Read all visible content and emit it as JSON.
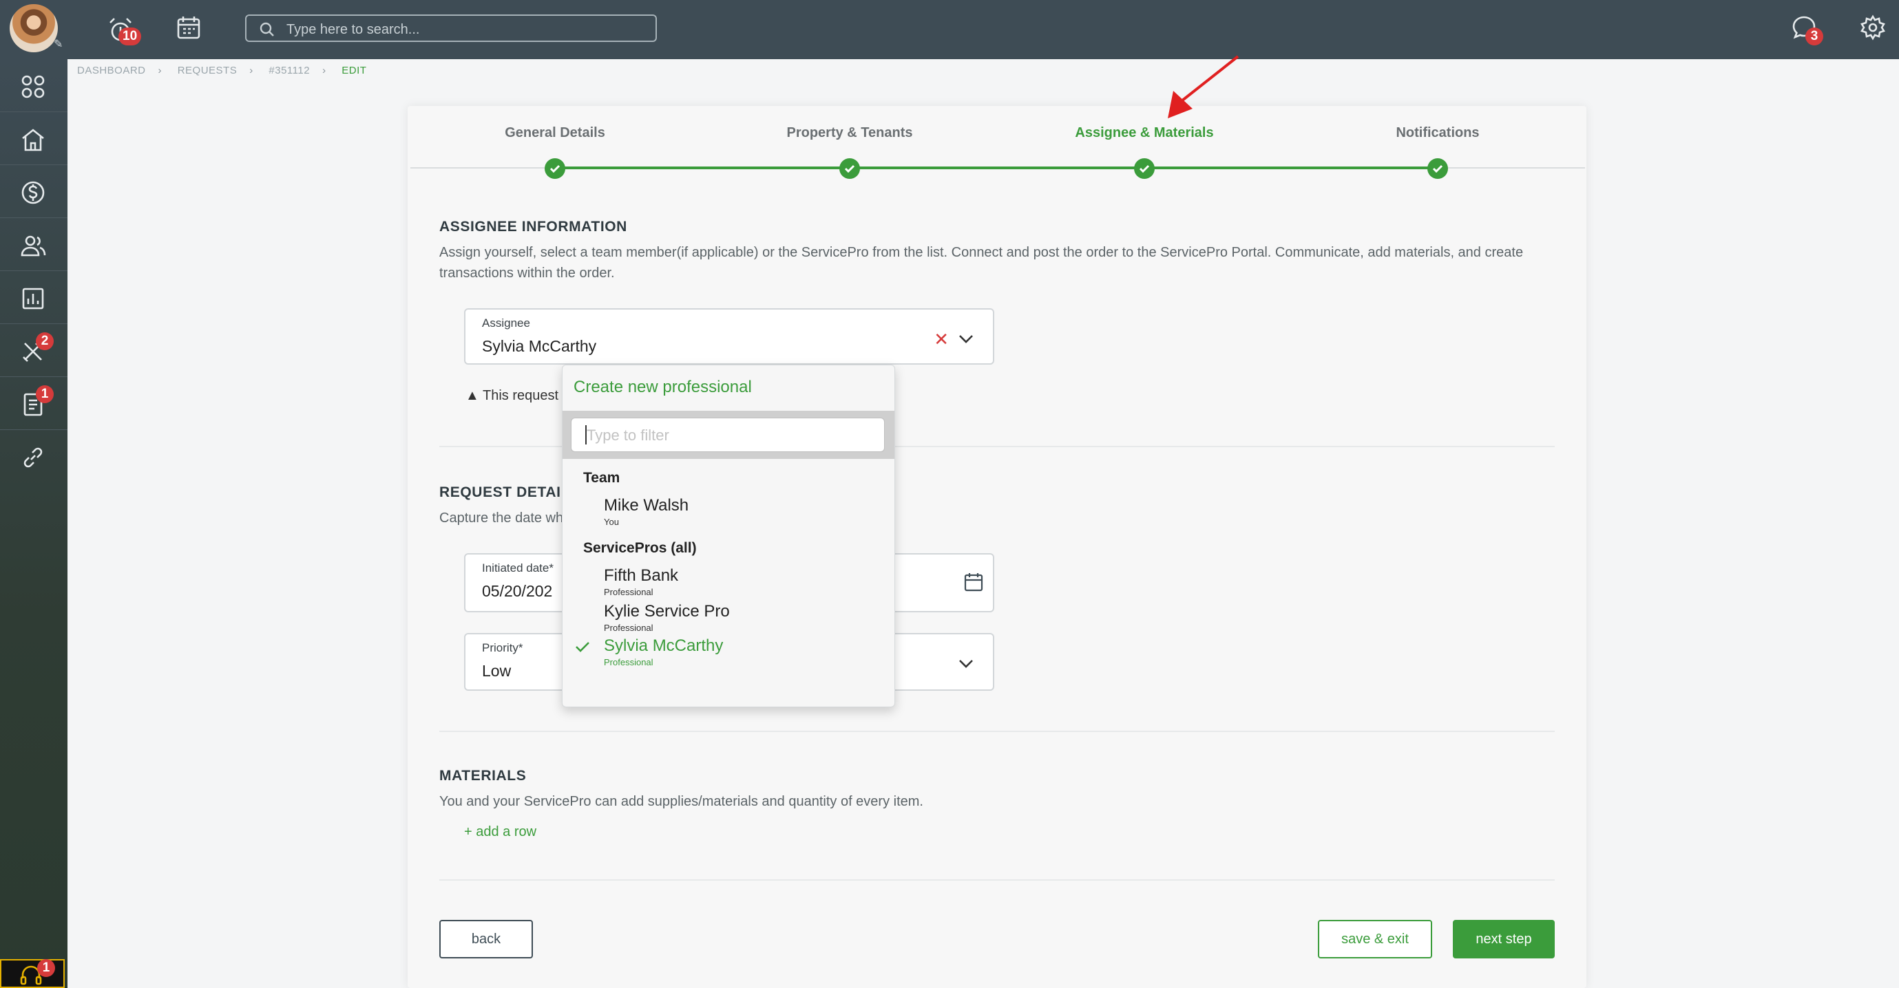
{
  "topbar": {
    "notifications_badge": "10",
    "search_placeholder": "Type here to search...",
    "messages_badge": "3"
  },
  "sidebar": {
    "items": [
      {
        "icon": "dashboard-grid-icon"
      },
      {
        "icon": "home-icon"
      },
      {
        "icon": "dollar-icon"
      },
      {
        "icon": "people-icon"
      },
      {
        "icon": "chart-icon"
      },
      {
        "icon": "tools-icon",
        "badge": "2"
      },
      {
        "icon": "document-icon",
        "badge": "1"
      },
      {
        "icon": "link-icon"
      }
    ],
    "support_badge": "1"
  },
  "breadcrumb": [
    "DASHBOARD",
    "REQUESTS",
    "#351112",
    "EDIT"
  ],
  "steps": [
    "General Details",
    "Property & Tenants",
    "Assignee & Materials",
    "Notifications"
  ],
  "assignee_section": {
    "title": "ASSIGNEE INFORMATION",
    "desc_line1": "Assign yourself, select a team member(if applicable) or the ServicePro from the list. Connect and post the order to the ServicePro Portal. Communicate, add materials, and create",
    "desc_line2": "transactions within the order.",
    "field_label": "Assignee",
    "field_value": "Sylvia McCarthy",
    "warning": "This request"
  },
  "request_section": {
    "title": "REQUEST DETAIL",
    "desc": "Capture the date wh",
    "date_label": "Initiated date*",
    "date_value": "05/20/202",
    "priority_label": "Priority*",
    "priority_value": "Low"
  },
  "materials_section": {
    "title": "MATERIALS",
    "desc": "You and your ServicePro can add supplies/materials and quantity of every item.",
    "add_row": "+ add a row"
  },
  "buttons": {
    "back": "back",
    "save_exit": "save & exit",
    "next": "next step"
  },
  "dropdown": {
    "create_label": "Create new professional",
    "filter_placeholder": "Type to filter",
    "team_group": "Team",
    "team_options": [
      {
        "name": "Mike Walsh",
        "sub": "You"
      }
    ],
    "pros_group": "ServicePros (all)",
    "pro_options": [
      {
        "name": "Fifth Bank",
        "sub": "Professional"
      },
      {
        "name": "Kylie Service Pro",
        "sub": "Professional"
      },
      {
        "name": "Sylvia McCarthy",
        "sub": "Professional",
        "selected": true
      }
    ]
  },
  "colors": {
    "accent": "#3b9c3b",
    "topbar": "#3e4c55",
    "badge": "#d63b3b"
  }
}
